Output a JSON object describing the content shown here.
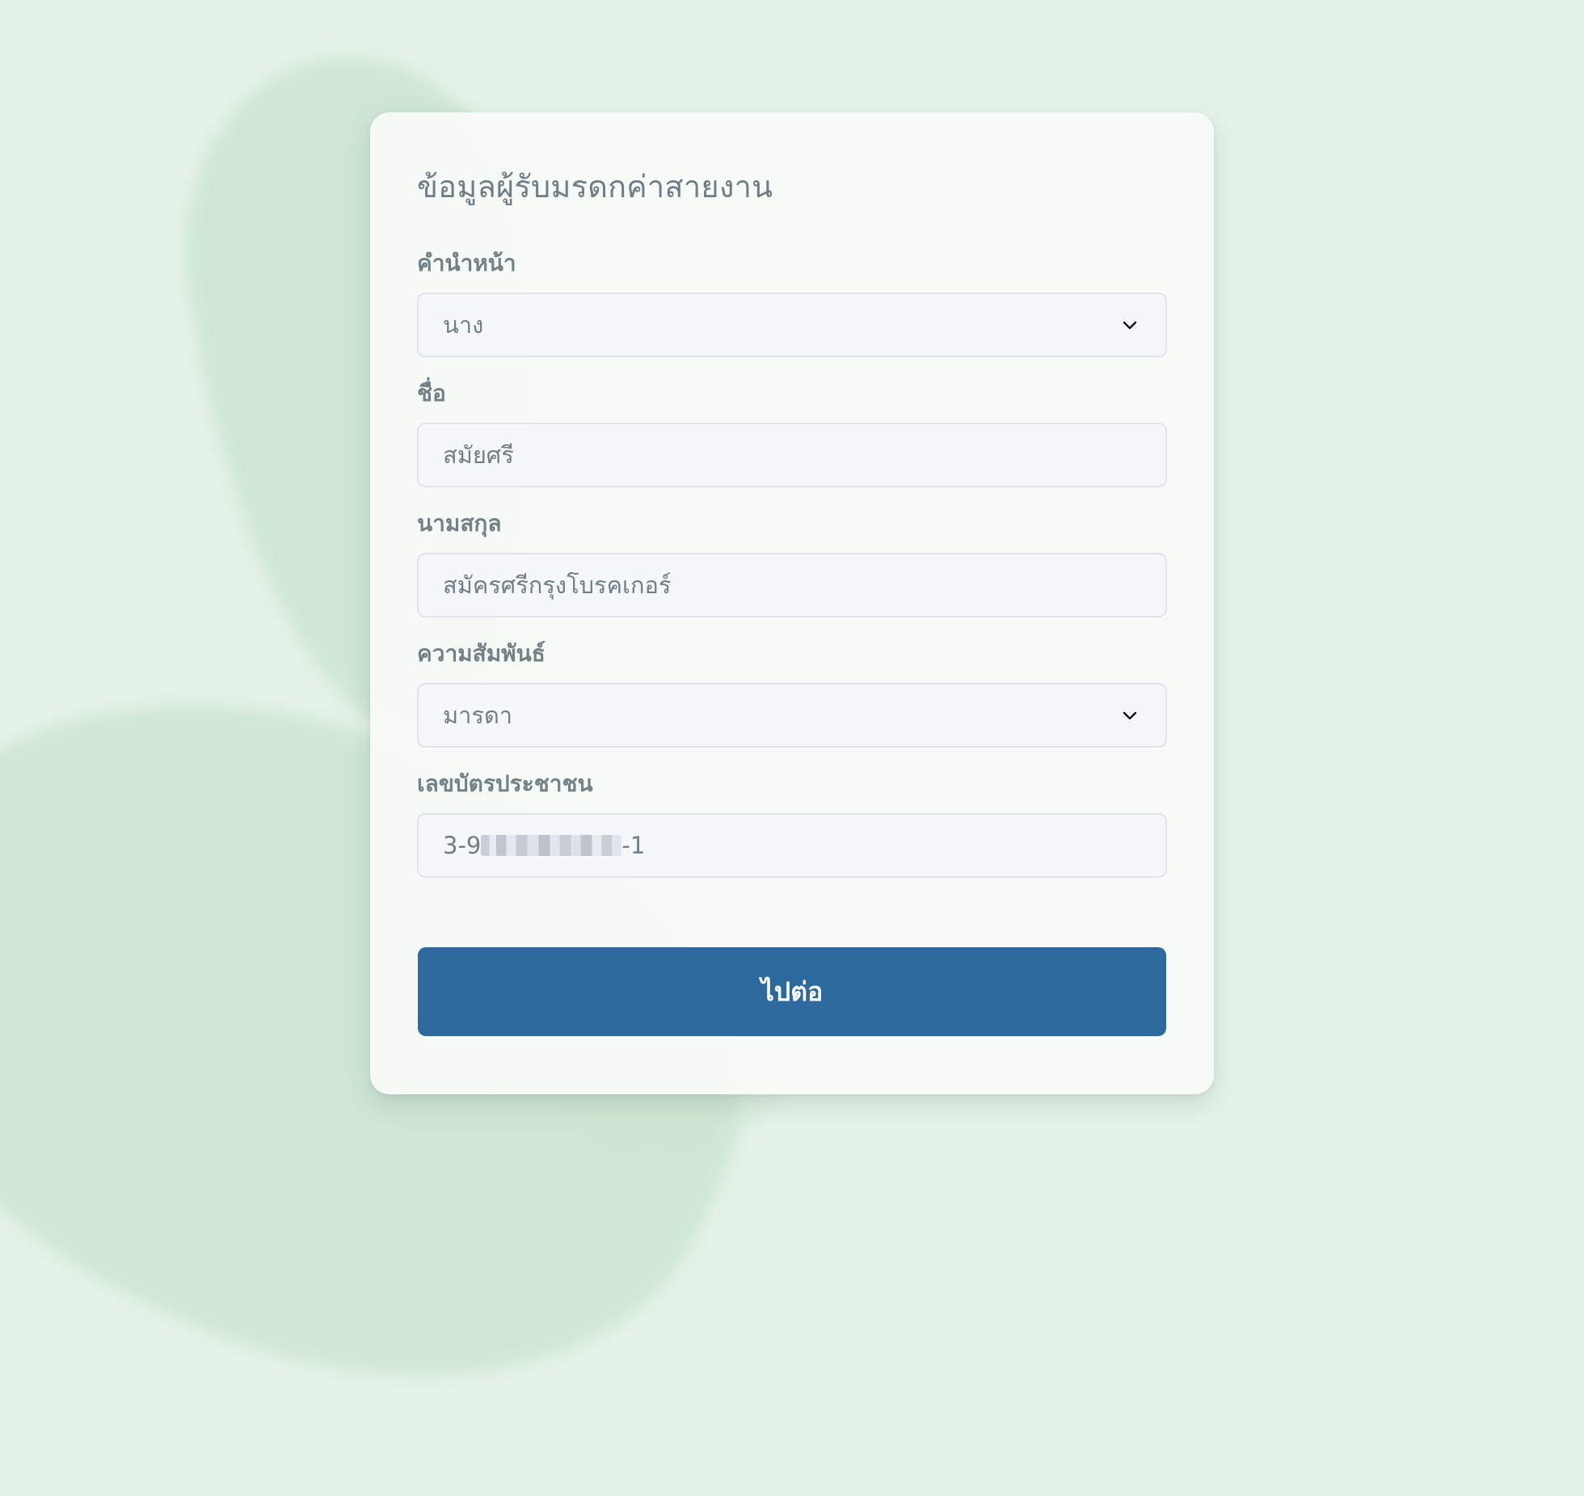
{
  "form": {
    "title": "ข้อมูลผู้รับมรดกค่าสายงาน",
    "title_label": "คำนำหน้า",
    "title_value": "นาง",
    "first_name_label": "ชื่อ",
    "first_name_value": "สมัยศรี",
    "last_name_label": "นามสกุล",
    "last_name_value": "สมัครศรีกรุงโบรคเกอร์",
    "relation_label": "ความสัมพันธ์",
    "relation_value": "มารดา",
    "id_label": "เลขบัตรประชาชน",
    "id_prefix": "3-9",
    "id_suffix": "-1",
    "submit_label": "ไปต่อ"
  },
  "icons": {
    "dropdown_icon": "chevron-down-icon"
  },
  "colors": {
    "background": "#e4f2e7",
    "card": "#f7fbf8",
    "field_bg": "#f5f7fb",
    "field_border": "#dfe3ec",
    "label": "#738187",
    "title": "#6f7e84",
    "button": "#2c6a9d",
    "button_text": "#ffffff"
  }
}
